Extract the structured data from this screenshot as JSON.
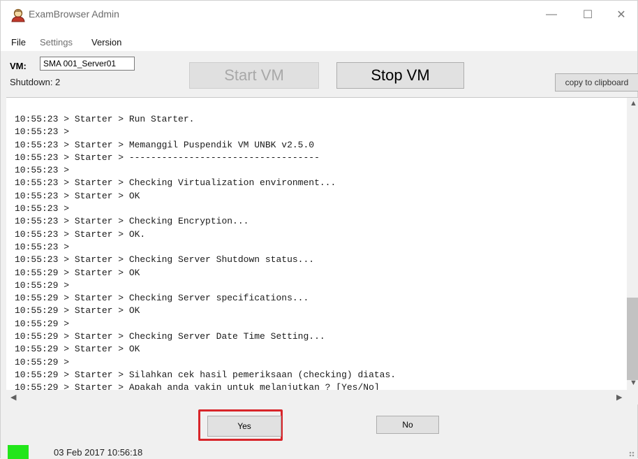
{
  "window": {
    "title": "ExamBrowser Admin",
    "controls": {
      "minimize": "—",
      "maximize": "☐",
      "close": "✕"
    }
  },
  "menu": {
    "items": [
      {
        "label": "File",
        "dim": false
      },
      {
        "label": "Settings",
        "dim": true
      },
      {
        "label": "Version",
        "dim": false
      }
    ]
  },
  "vm": {
    "label": "VM:",
    "value": "SMA 001_Server01"
  },
  "shutdown": {
    "label": "Shutdown:  2"
  },
  "buttons": {
    "start_vm": "Start VM",
    "stop_vm": "Stop VM",
    "copy": "copy to clipboard",
    "yes": "Yes",
    "no": "No"
  },
  "log": {
    "lines": [
      "10:55:23 > Starter > Run Starter.",
      "10:55:23 >",
      "10:55:23 > Starter > Memanggil Puspendik VM UNBK v2.5.0",
      "10:55:23 > Starter > -----------------------------------",
      "10:55:23 >",
      "10:55:23 > Starter > Checking Virtualization environment...",
      "10:55:23 > Starter > OK",
      "10:55:23 >",
      "10:55:23 > Starter > Checking Encryption...",
      "10:55:23 > Starter > OK.",
      "10:55:23 >",
      "10:55:23 > Starter > Checking Server Shutdown status...",
      "10:55:29 > Starter > OK",
      "10:55:29 >",
      "10:55:29 > Starter > Checking Server specifications...",
      "10:55:29 > Starter > OK",
      "10:55:29 >",
      "10:55:29 > Starter > Checking Server Date Time Setting...",
      "10:55:29 > Starter > OK",
      "10:55:29 >",
      "10:55:29 > Starter > Silahkan cek hasil pemeriksaan (checking) diatas.",
      "10:55:29 > Starter > Apakah anda yakin untuk melanjutkan ? [Yes/No]"
    ]
  },
  "status": {
    "indicator_color": "#22e61a",
    "text": "03 Feb 2017 10:56:18"
  },
  "colors": {
    "highlight": "#d8252a"
  }
}
